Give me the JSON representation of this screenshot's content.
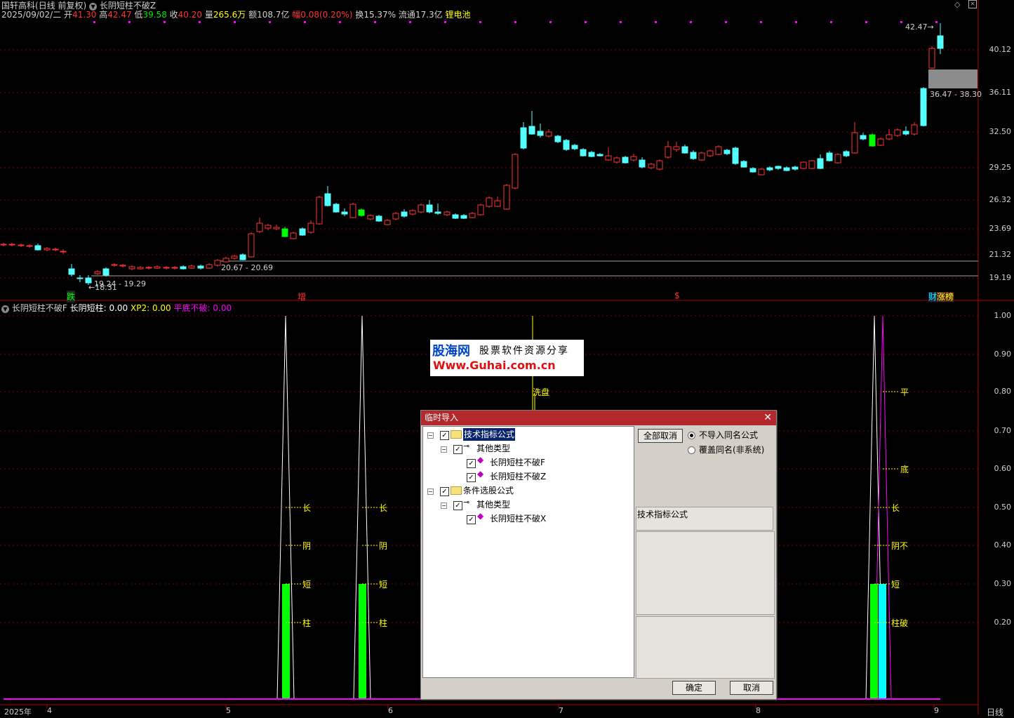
{
  "header": {
    "stock_name": "国轩高科",
    "period": "(日线 前复权)",
    "formula_title": "长阴短柱不破Z",
    "date": "2025/09/02/二",
    "open_label": "开",
    "open": "41.30",
    "high_label": "高",
    "high": "42.47",
    "low_label": "低",
    "low": "39.58",
    "close_label": "收",
    "close": "40.20",
    "volume_label": "量",
    "volume": "265.6万",
    "amount_label": "额",
    "amount": "108.7亿",
    "change_label": "幅",
    "change": "0.08(0.20%)",
    "turnover_label": "换",
    "turnover": "15.37%",
    "float_label": "流通",
    "float": "17.3亿",
    "sector": "锂电池"
  },
  "price_axis": [
    "40.12",
    "36.11",
    "32.50",
    "29.25",
    "26.32",
    "23.69",
    "21.32",
    "19.19"
  ],
  "price_notes": {
    "high_mark": "42.47",
    "low_mark": "18.31",
    "range_low": "19.24 - 19.29",
    "range_mid": "20.67 - 20.69",
    "range_high": "36.47 - 38.30"
  },
  "event_tags": [
    "跌",
    "增",
    "$",
    "财",
    "涨榜"
  ],
  "indicator_header": {
    "name": "长阴短柱不破F",
    "s1_label": "长阴短柱:",
    "s1_value": "0.00",
    "s2_label": "XP2:",
    "s2_value": "0.00",
    "s3_label": "平底不破:",
    "s3_value": "0.00"
  },
  "indicator_axis": [
    "1.00",
    "0.90",
    "0.80",
    "0.70",
    "0.60",
    "0.50",
    "0.40",
    "0.30",
    "0.20"
  ],
  "indicator_labels": {
    "chang": "长",
    "yin": "阴",
    "duan": "短",
    "zhu": "柱",
    "xipan": "洗盘",
    "ping": "平",
    "di": "底",
    "yinbu": "阴不",
    "zhupo": "柱破"
  },
  "watermark": {
    "logo": "股海网",
    "slogan": "股票软件资源分享",
    "url": "Www.Guhai.com.cn"
  },
  "time_axis": [
    "2025年",
    "4",
    "5",
    "6",
    "7",
    "8",
    "9"
  ],
  "period_button": "日线",
  "dialog": {
    "title": "临时导入",
    "tree": [
      {
        "label": "技术指标公式",
        "checked": true,
        "selected": true
      },
      {
        "label": "其他类型",
        "checked": true
      },
      {
        "label": "长阴短柱不破F",
        "checked": true
      },
      {
        "label": "长阴短柱不破Z",
        "checked": true
      },
      {
        "label": "条件选股公式",
        "checked": true
      },
      {
        "label": "其他类型",
        "checked": true
      },
      {
        "label": "长阴短柱不破X",
        "checked": true
      }
    ],
    "deselect_all": "全部取消",
    "radio_skip": "不导入同名公式",
    "radio_overwrite": "覆盖同名(非系统)",
    "category_label": "技术指标公式",
    "ok": "确定",
    "cancel": "取消"
  },
  "colors": {
    "up": "#ff3232",
    "down": "#54ffff",
    "green": "#00ff00",
    "grid": "#8b0000",
    "magenta": "#ff00ff",
    "yellow": "#ffff00"
  }
}
